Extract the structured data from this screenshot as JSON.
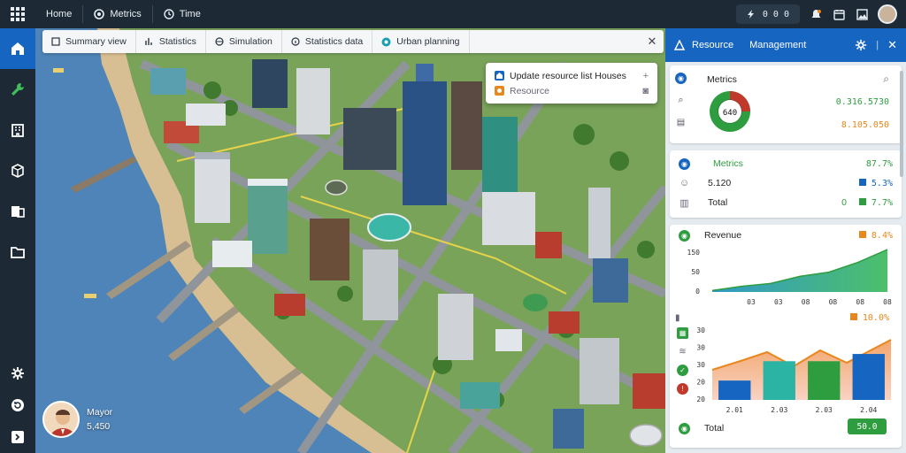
{
  "topbar": {
    "items": [
      {
        "label": "Home"
      },
      {
        "label": "Metrics"
      },
      {
        "label": "Time"
      }
    ],
    "counter": "0 0 0"
  },
  "tabs": [
    {
      "label": "Summary view"
    },
    {
      "label": "Statistics"
    },
    {
      "label": "Simulation"
    },
    {
      "label": "Statistics data"
    },
    {
      "label": "Urban planning"
    }
  ],
  "popup": {
    "title": "Update resource list Houses",
    "subtitle": "Resource"
  },
  "profile": {
    "name": "Mayor",
    "value": "5,450"
  },
  "panel": {
    "title": "Resource",
    "subtitle": "Management",
    "overview": {
      "heading": "Metrics",
      "gauge_label": "640",
      "value1": "0.316.5730",
      "value2": "8.105.050"
    },
    "metrics": {
      "heading": "Metrics",
      "pct": "87.7%",
      "row1_label": "5.120",
      "row1_val": "5.3%",
      "row2_label": "Total",
      "row2_prefix": "0",
      "row2_val": "7.7%"
    },
    "chart1": {
      "heading": "Revenue",
      "pct": "8.4%",
      "yticks": [
        "150",
        "50",
        "0"
      ],
      "xticks": [
        "03",
        "03",
        "08",
        "08",
        "08",
        "08"
      ]
    },
    "chart2": {
      "pct": "10.0%",
      "yticks": [
        "30",
        "30",
        "30",
        "20",
        "20"
      ],
      "xticks": [
        "2.01",
        "2.03",
        "2.03",
        "2.04"
      ]
    },
    "footer": {
      "label": "Total",
      "button": "50.0"
    }
  },
  "chart_data": [
    {
      "type": "area",
      "x": [
        "03",
        "03",
        "08",
        "08",
        "08",
        "08"
      ],
      "series": [
        {
          "values": [
            5,
            20,
            30,
            55,
            70,
            105,
            150
          ]
        }
      ],
      "ylim": [
        0,
        150
      ]
    },
    {
      "type": "bar",
      "categories": [
        "2.01",
        "2.03",
        "2.03",
        "2.04"
      ],
      "values": [
        8,
        16,
        16,
        19
      ],
      "ylim": [
        0,
        30
      ]
    }
  ],
  "colors": {
    "accent": "#1665c0",
    "green": "#2e9d3f",
    "orange": "#e8871e",
    "teal": "#2bb3a3",
    "topbar": "#1d2a36"
  }
}
